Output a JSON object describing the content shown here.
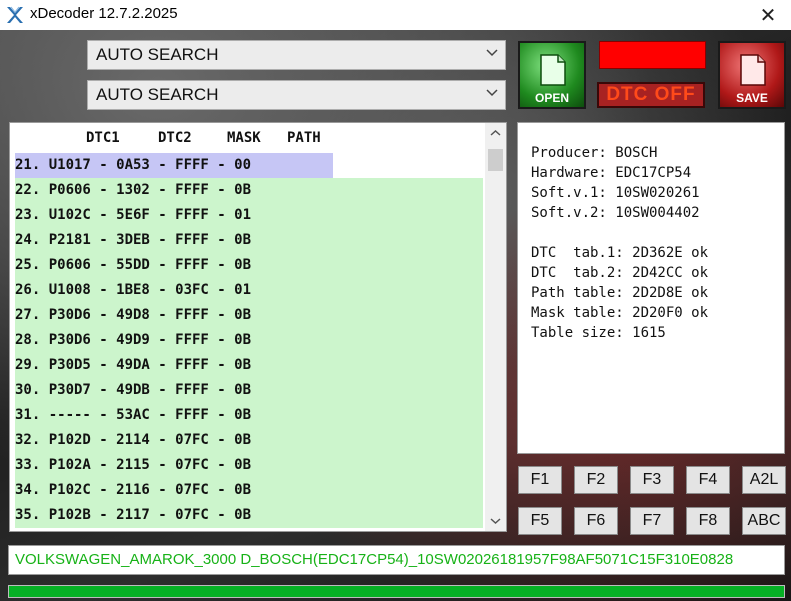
{
  "window": {
    "title": "xDecoder 12.7.2.2025",
    "close_glyph": "✕"
  },
  "search": {
    "combo1_value": "AUTO SEARCH",
    "combo2_value": "AUTO SEARCH"
  },
  "toolbar": {
    "open_label": "OPEN",
    "save_label": "SAVE",
    "dtc_off_label": "DTC OFF",
    "indicator_color": "#ff0000"
  },
  "dtc_list": {
    "headers": [
      "DTC1",
      "DTC2",
      "MASK",
      "PATH"
    ],
    "rows": [
      "21. U1017 - 0A53 - FFFF - 00",
      "22. P0606 - 1302 - FFFF - 0B",
      "23. U102C - 5E6F - FFFF - 01",
      "24. P2181 - 3DEB - FFFF - 0B",
      "25. P0606 - 55DD - FFFF - 0B",
      "26. U1008 - 1BE8 - 03FC - 01",
      "27. P30D6 - 49D8 - FFFF - 0B",
      "28. P30D6 - 49D9 - FFFF - 0B",
      "29. P30D5 - 49DA - FFFF - 0B",
      "30. P30D7 - 49DB - FFFF - 0B",
      "31. ----- - 53AC - FFFF - 0B",
      "32. P102D - 2114 - 07FC - 0B",
      "33. P102A - 2115 - 07FC - 0B",
      "34. P102C - 2116 - 07FC - 0B",
      "35. P102B - 2117 - 07FC - 0B"
    ],
    "selected_color": "#c6c6f5",
    "row_color": "#ccf5cc"
  },
  "info": {
    "producer": "Producer: BOSCH",
    "hardware": "Hardware: EDC17CP54",
    "soft1": "Soft.v.1: 10SW020261",
    "soft2": "Soft.v.2: 10SW004402",
    "dtc_tab1": "DTC  tab.1: 2D362E ok",
    "dtc_tab2": "DTC  tab.2: 2D42CC ok",
    "path_table": "Path table: 2D2D8E ok",
    "mask_table": "Mask table: 2D20F0 ok",
    "table_size": "Table size: 1615"
  },
  "function_buttons": {
    "f1": "F1",
    "f2": "F2",
    "f3": "F3",
    "f4": "F4",
    "a2l": "A2L",
    "f5": "F5",
    "f6": "F6",
    "f7": "F7",
    "f8": "F8",
    "abc": "ABC"
  },
  "status": {
    "filename": "VOLKSWAGEN_AMAROK_3000 D_BOSCH(EDC17CP54)_10SW02026181957F98AF5071C15F310E0828",
    "text_color": "#17b217"
  },
  "progress": {
    "fraction": 1.0,
    "color": "#06b025"
  }
}
